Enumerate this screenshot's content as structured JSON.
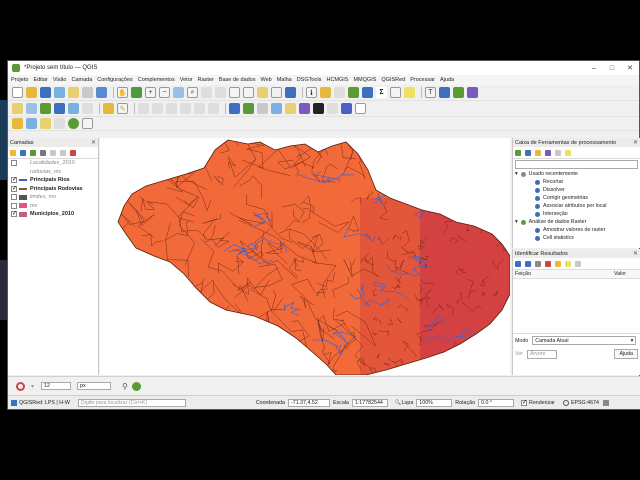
{
  "window": {
    "title": "*Projeto sem título — QGIS",
    "min": "–",
    "max": "□",
    "close": "✕"
  },
  "menu": [
    "Projeto",
    "Editar",
    "Visão",
    "Camada",
    "Configurações",
    "Complementos",
    "Vetor",
    "Raster",
    "Base de dados",
    "Web",
    "Malha",
    "DSGTools",
    "HCMGIS",
    "MMQGIS",
    "QGISRed",
    "Processar",
    "Ajuda"
  ],
  "layers_panel": {
    "title": "Camadas",
    "layers": [
      {
        "name": "Localidades_2010",
        "checked": false,
        "style": "dim",
        "swatch": ""
      },
      {
        "name": "rodovias_ms",
        "checked": false,
        "style": "dim",
        "swatch": ""
      },
      {
        "name": "Principais Rios",
        "checked": true,
        "style": "bold",
        "swatch": "#3b5bd6"
      },
      {
        "name": "Principais Rodovias",
        "checked": true,
        "style": "bold",
        "swatch": "#7a5a3a"
      },
      {
        "name": "limites_ms",
        "checked": false,
        "style": "dim",
        "swatch": "#555555"
      },
      {
        "name": "ms",
        "checked": false,
        "style": "dim",
        "swatch": "#e8508c"
      },
      {
        "name": "Municipios_2010",
        "checked": true,
        "style": "bold",
        "swatch": "#c0607a"
      }
    ]
  },
  "toolbox": {
    "title": "Caixa de Ferramentas de processamento",
    "recent_label": "Usado recentemente",
    "recent": [
      "Recortar",
      "Dissolver",
      "Corrigir geometrias",
      "Associar atributos por local",
      "Interseção"
    ],
    "raster_label": "Análise de dados Raster",
    "raster": [
      "Amostrar valores de raster",
      "Cell statistics"
    ]
  },
  "identify": {
    "title": "Identificar Resultados",
    "col_feature": "Feição",
    "col_value": "Valor",
    "mode_label": "Modo",
    "mode_value": "Camada Atual",
    "view_label": "Ver",
    "view_value": "Árvore",
    "help_button": "Ajuda"
  },
  "snapping": {
    "tolerance": "12",
    "unit": "px"
  },
  "status": {
    "plugin": "QGISRed: LPS | H-W",
    "search_placeholder": "Digite para localizar (Ctrl+K)",
    "coord_label": "Coordenada",
    "coord_value": "-71.37,4.52",
    "scale_label": "Escala",
    "scale_value": "1:17782544",
    "magnifier_label": "Lupa",
    "magnifier_value": "100%",
    "rotation_label": "Rotação",
    "rotation_value": "0.0 °",
    "render_label": "Renderizar",
    "crs": "EPSG:4674"
  },
  "colors": {
    "municipios_fill": "#f26a3a",
    "municipios_border": "#7a2a14",
    "rivers": "#4a5fc8",
    "dense_east": "#c8324a",
    "qgis_green": "#5b9b33"
  }
}
